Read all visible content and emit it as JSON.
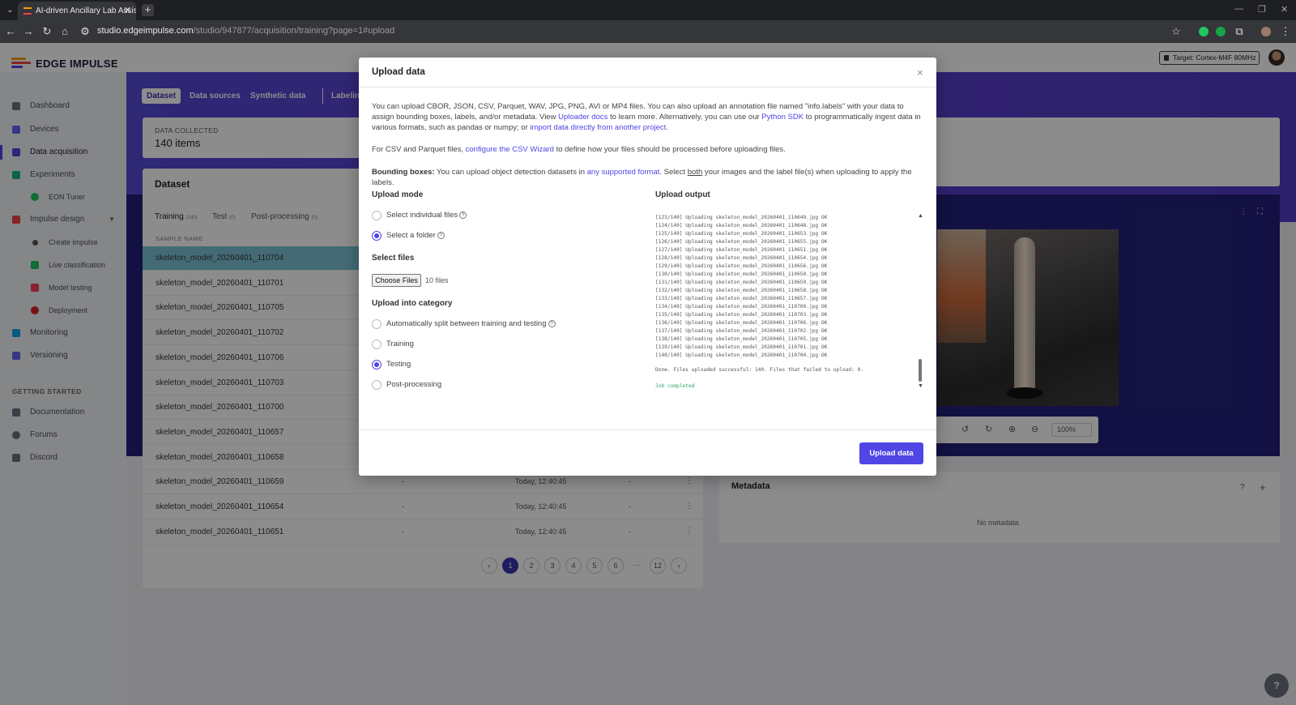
{
  "browser": {
    "tab_title": "AI-driven Ancillary Lab Assistant",
    "url_host": "studio.edgeimpulse.com",
    "url_path": "/studio/947877/acquisition/training?page=1#upload"
  },
  "header": {
    "brand": "EDGE IMPULSE",
    "target": "Target: Cortex-M4F 80MHz"
  },
  "sidebar": {
    "items": [
      {
        "label": "Dashboard"
      },
      {
        "label": "Devices"
      },
      {
        "label": "Data acquisition"
      },
      {
        "label": "Experiments"
      },
      {
        "label": "EON Tuner"
      },
      {
        "label": "Impulse design"
      },
      {
        "label": "Create impulse"
      },
      {
        "label": "Live classification"
      },
      {
        "label": "Model testing"
      },
      {
        "label": "Deployment"
      },
      {
        "label": "Monitoring"
      },
      {
        "label": "Versioning"
      }
    ],
    "section_title": "GETTING STARTED",
    "getting_started": [
      {
        "label": "Documentation"
      },
      {
        "label": "Forums"
      },
      {
        "label": "Discord"
      }
    ]
  },
  "main": {
    "pills": [
      "Dataset",
      "Data sources",
      "Synthetic data",
      "Labeling"
    ],
    "stat_label": "DATA COLLECTED",
    "stat_value": "140 items",
    "dataset_title": "Dataset",
    "subtabs": [
      {
        "label": "Training",
        "count": "(140)"
      },
      {
        "label": "Test",
        "count": "(0)"
      },
      {
        "label": "Post-processing",
        "count": "(0)"
      }
    ],
    "col_sample_name": "SAMPLE NAME",
    "rows": [
      {
        "name": "skeleton_model_20260401_110704",
        "c2": "",
        "c3": "",
        "c4": ""
      },
      {
        "name": "skeleton_model_20260401_110701",
        "c2": "",
        "c3": "",
        "c4": ""
      },
      {
        "name": "skeleton_model_20260401_110705",
        "c2": "",
        "c3": "",
        "c4": ""
      },
      {
        "name": "skeleton_model_20260401_110702",
        "c2": "",
        "c3": "",
        "c4": ""
      },
      {
        "name": "skeleton_model_20260401_110706",
        "c2": "",
        "c3": "",
        "c4": ""
      },
      {
        "name": "skeleton_model_20260401_110703",
        "c2": "",
        "c3": "",
        "c4": ""
      },
      {
        "name": "skeleton_model_20260401_110700",
        "c2": "",
        "c3": "",
        "c4": ""
      },
      {
        "name": "skeleton_model_20260401_110657",
        "c2": "",
        "c3": "",
        "c4": ""
      },
      {
        "name": "skeleton_model_20260401_110658",
        "c2": "",
        "c3": "",
        "c4": ""
      },
      {
        "name": "skeleton_model_20260401_110659",
        "c2": "-",
        "c3": "Today, 12:40:45",
        "c4": "-"
      },
      {
        "name": "skeleton_model_20260401_110654",
        "c2": "-",
        "c3": "Today, 12:40:45",
        "c4": "-"
      },
      {
        "name": "skeleton_model_20260401_110651",
        "c2": "-",
        "c3": "Today, 12:40:45",
        "c4": "-"
      }
    ],
    "pages": [
      "1",
      "2",
      "3",
      "4",
      "5",
      "6",
      "···",
      "12"
    ],
    "zoom": "100%",
    "metadata_title": "Metadata",
    "metadata_empty": "No metadata."
  },
  "modal": {
    "title": "Upload data",
    "intro_1": "You can upload CBOR, JSON, CSV, Parquet, WAV, JPG, PNG, AVI or MP4 files. You can also upload an annotation file named \"info.labels\" with your data to assign bounding boxes, labels, and/or metadata. View ",
    "intro_link_1": "Uploader docs",
    "intro_2": " to learn more. Alternatively, you can use our ",
    "intro_link_2": "Python SDK",
    "intro_3": " to programmatically ingest data in various formats, such as pandas or numpy; or ",
    "intro_link_3": "import data directly from another project",
    "intro_4": ".",
    "csv_1": "For CSV and Parquet files, ",
    "csv_link": "configure the CSV Wizard",
    "csv_2": " to define how your files should be processed before uploading files.",
    "bbox_bold": "Bounding boxes:",
    "bbox_1": " You can upload object detection datasets in ",
    "bbox_link": "any supported format",
    "bbox_2": ". Select ",
    "bbox_u": "both",
    "bbox_3": " your images and the label file(s) when uploading to apply the labels.",
    "upload_mode_title": "Upload mode",
    "mode_individual": "Select individual files",
    "mode_folder": "Select a folder",
    "select_files_title": "Select files",
    "choose_files": "Choose Files",
    "file_count": "10 files",
    "category_title": "Upload into category",
    "cat_auto": "Automatically split between training and testing",
    "cat_training": "Training",
    "cat_testing": "Testing",
    "cat_post": "Post-processing",
    "output_title": "Upload output",
    "log": [
      "[123/140] Uploading skeleton_model_20260401_110649.jpg OK",
      "[124/140] Uploading skeleton_model_20260401_110648.jpg OK",
      "[125/140] Uploading skeleton_model_20260401_110653.jpg OK",
      "[126/140] Uploading skeleton_model_20260401_110655.jpg OK",
      "[127/140] Uploading skeleton_model_20260401_110651.jpg OK",
      "[128/140] Uploading skeleton_model_20260401_110654.jpg OK",
      "[129/140] Uploading skeleton_model_20260401_110656.jpg OK",
      "[130/140] Uploading skeleton_model_20260401_110650.jpg OK",
      "[131/140] Uploading skeleton_model_20260401_110659.jpg OK",
      "[132/140] Uploading skeleton_model_20260401_110658.jpg OK",
      "[133/140] Uploading skeleton_model_20260401_110657.jpg OK",
      "[134/140] Uploading skeleton_model_20260401_110700.jpg OK",
      "[135/140] Uploading skeleton_model_20260401_110703.jpg OK",
      "[136/140] Uploading skeleton_model_20260401_110706.jpg OK",
      "[137/140] Uploading skeleton_model_20260401_110702.jpg OK",
      "[138/140] Uploading skeleton_model_20260401_110705.jpg OK",
      "[139/140] Uploading skeleton_model_20260401_110701.jpg OK",
      "[140/140] Uploading skeleton_model_20260401_110704.jpg OK"
    ],
    "done": "Done. Files uploaded successful: 140. Files that failed to upload: 0.",
    "job": "Job completed",
    "upload_button": "Upload data"
  },
  "colors": {
    "accent": "#4f46e5",
    "banner": "#5549d6",
    "selected_row": "#7cc4d6",
    "success": "#2fa36b"
  }
}
